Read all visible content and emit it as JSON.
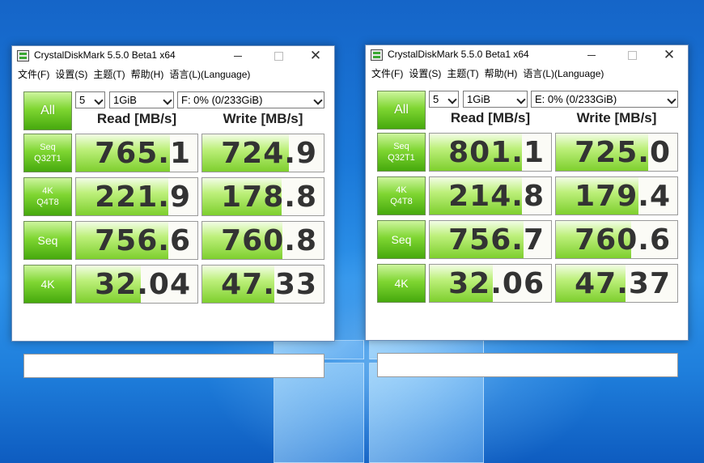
{
  "windows": [
    {
      "title": "CrystalDiskMark 5.5.0 Beta1 x64",
      "menu": [
        "文件(F)",
        "设置(S)",
        "主题(T)",
        "帮助(H)",
        "语言(L)(Language)"
      ],
      "all_label": "All",
      "count": "5",
      "size": "1GiB",
      "drive": "F: 0% (0/233GiB)",
      "read_header": "Read [MB/s]",
      "write_header": "Write [MB/s]",
      "rows": [
        {
          "line1": "Seq",
          "line2": "Q32T1",
          "read": "765.1",
          "write": "724.9",
          "read_fill": 0.77,
          "write_fill": 0.71
        },
        {
          "line1": "4K",
          "line2": "Q4T8",
          "read": "221.9",
          "write": "178.8",
          "read_fill": 0.76,
          "write_fill": 0.65
        },
        {
          "line1": "Seq",
          "line2": "",
          "read": "756.6",
          "write": "760.8",
          "read_fill": 0.76,
          "write_fill": 0.66
        },
        {
          "line1": "4K",
          "line2": "",
          "read": "32.04",
          "write": "47.33",
          "read_fill": 0.53,
          "write_fill": 0.59
        }
      ],
      "comment": ""
    },
    {
      "title": "CrystalDiskMark 5.5.0 Beta1 x64",
      "menu": [
        "文件(F)",
        "设置(S)",
        "主题(T)",
        "帮助(H)",
        "语言(L)(Language)"
      ],
      "all_label": "All",
      "count": "5",
      "size": "1GiB",
      "drive": "E: 0% (0/233GiB)",
      "read_header": "Read [MB/s]",
      "write_header": "Write [MB/s]",
      "rows": [
        {
          "line1": "Seq",
          "line2": "Q32T1",
          "read": "801.1",
          "write": "725.0",
          "read_fill": 0.76,
          "write_fill": 0.76
        },
        {
          "line1": "4K",
          "line2": "Q4T8",
          "read": "214.8",
          "write": "179.4",
          "read_fill": 0.76,
          "write_fill": 0.68
        },
        {
          "line1": "Seq",
          "line2": "",
          "read": "756.7",
          "write": "760.6",
          "read_fill": 0.77,
          "write_fill": 0.62
        },
        {
          "line1": "4K",
          "line2": "",
          "read": "32.06",
          "write": "47.37",
          "read_fill": 0.52,
          "write_fill": 0.57
        }
      ],
      "comment": ""
    }
  ]
}
